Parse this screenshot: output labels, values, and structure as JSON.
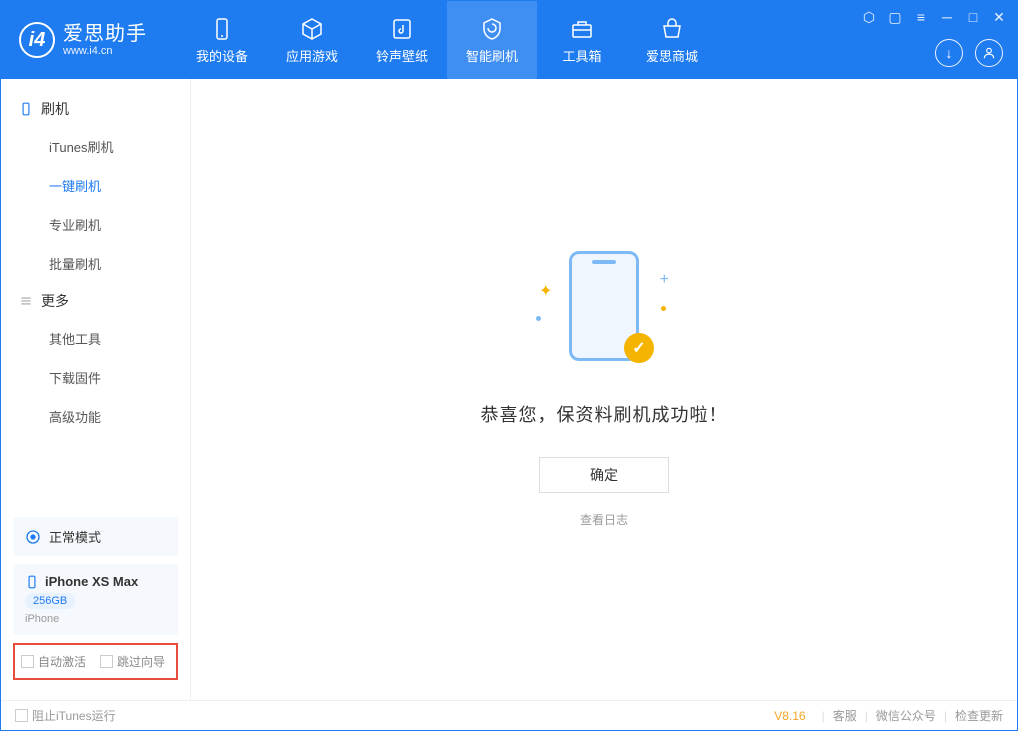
{
  "app": {
    "title": "爱思助手",
    "url": "www.i4.cn"
  },
  "nav": {
    "tabs": [
      {
        "label": "我的设备"
      },
      {
        "label": "应用游戏"
      },
      {
        "label": "铃声壁纸"
      },
      {
        "label": "智能刷机"
      },
      {
        "label": "工具箱"
      },
      {
        "label": "爱思商城"
      }
    ]
  },
  "sidebar": {
    "section1": {
      "title": "刷机"
    },
    "items1": [
      {
        "label": "iTunes刷机"
      },
      {
        "label": "一键刷机"
      },
      {
        "label": "专业刷机"
      },
      {
        "label": "批量刷机"
      }
    ],
    "section2": {
      "title": "更多"
    },
    "items2": [
      {
        "label": "其他工具"
      },
      {
        "label": "下载固件"
      },
      {
        "label": "高级功能"
      }
    ],
    "mode": {
      "label": "正常模式"
    },
    "device": {
      "name": "iPhone XS Max",
      "storage": "256GB",
      "type": "iPhone"
    },
    "checkboxes": {
      "auto_activate": "自动激活",
      "skip_guide": "跳过向导"
    }
  },
  "main": {
    "success_msg": "恭喜您，保资料刷机成功啦！",
    "ok_btn": "确定",
    "log_link": "查看日志"
  },
  "footer": {
    "block_itunes": "阻止iTunes运行",
    "version": "V8.16",
    "links": {
      "support": "客服",
      "wechat": "微信公众号",
      "update": "检查更新"
    }
  }
}
